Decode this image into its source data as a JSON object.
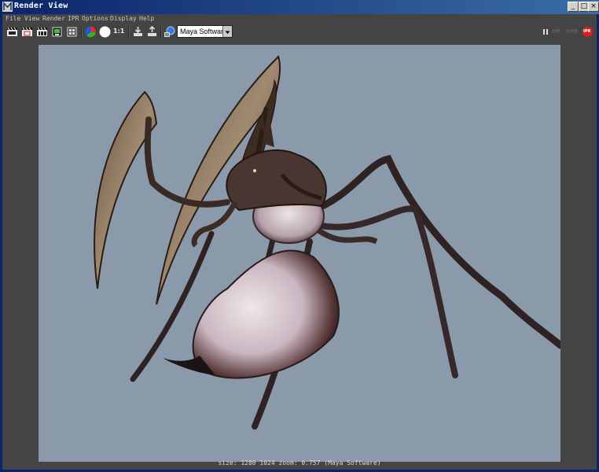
{
  "window": {
    "title": "Render View",
    "buttons": {
      "minimize": "_",
      "maximize": "□",
      "close": "×"
    }
  },
  "menu": [
    {
      "id": "file",
      "label": "File"
    },
    {
      "id": "view",
      "label": "View"
    },
    {
      "id": "render",
      "label": "Render"
    },
    {
      "id": "ipr",
      "label": "IPR"
    },
    {
      "id": "options",
      "label": "Options"
    },
    {
      "id": "display",
      "label": "Display"
    },
    {
      "id": "help",
      "label": "Help"
    }
  ],
  "toolbar": {
    "buttons": [
      {
        "id": "redo-render",
        "icon": "clapper-redo-icon"
      },
      {
        "id": "render-region",
        "icon": "clapper-region-icon"
      },
      {
        "id": "ipr-render",
        "icon": "ipr-clapper-icon"
      },
      {
        "id": "snapshot",
        "icon": "camera-snapshot-icon"
      },
      {
        "id": "render-settings",
        "icon": "settings-icon"
      },
      {
        "id": "rgb-channels",
        "icon": "rgb-channels-icon"
      },
      {
        "id": "alpha-channel",
        "icon": "alpha-channel-icon"
      },
      {
        "id": "real-size",
        "icon": "real-size-icon"
      },
      {
        "id": "keep-image",
        "icon": "keep-image-icon"
      },
      {
        "id": "remove-image",
        "icon": "remove-image-icon"
      },
      {
        "id": "display-render-settings",
        "icon": "render-globals-icon"
      }
    ],
    "real_size_label": "1:1",
    "renderer": "Maya Software",
    "ipr_status": {
      "ipr": "IPR",
      "mb": "0MB",
      "badge": "IPR"
    }
  },
  "status_line": "size: 1280 1024 zoom: 0.757  (Maya Software)",
  "colors": {
    "title_bar": "#0a246a",
    "panel_bg": "#444444",
    "viewport_bg": "#8a9aab",
    "ipr_badge": "#d42020"
  }
}
